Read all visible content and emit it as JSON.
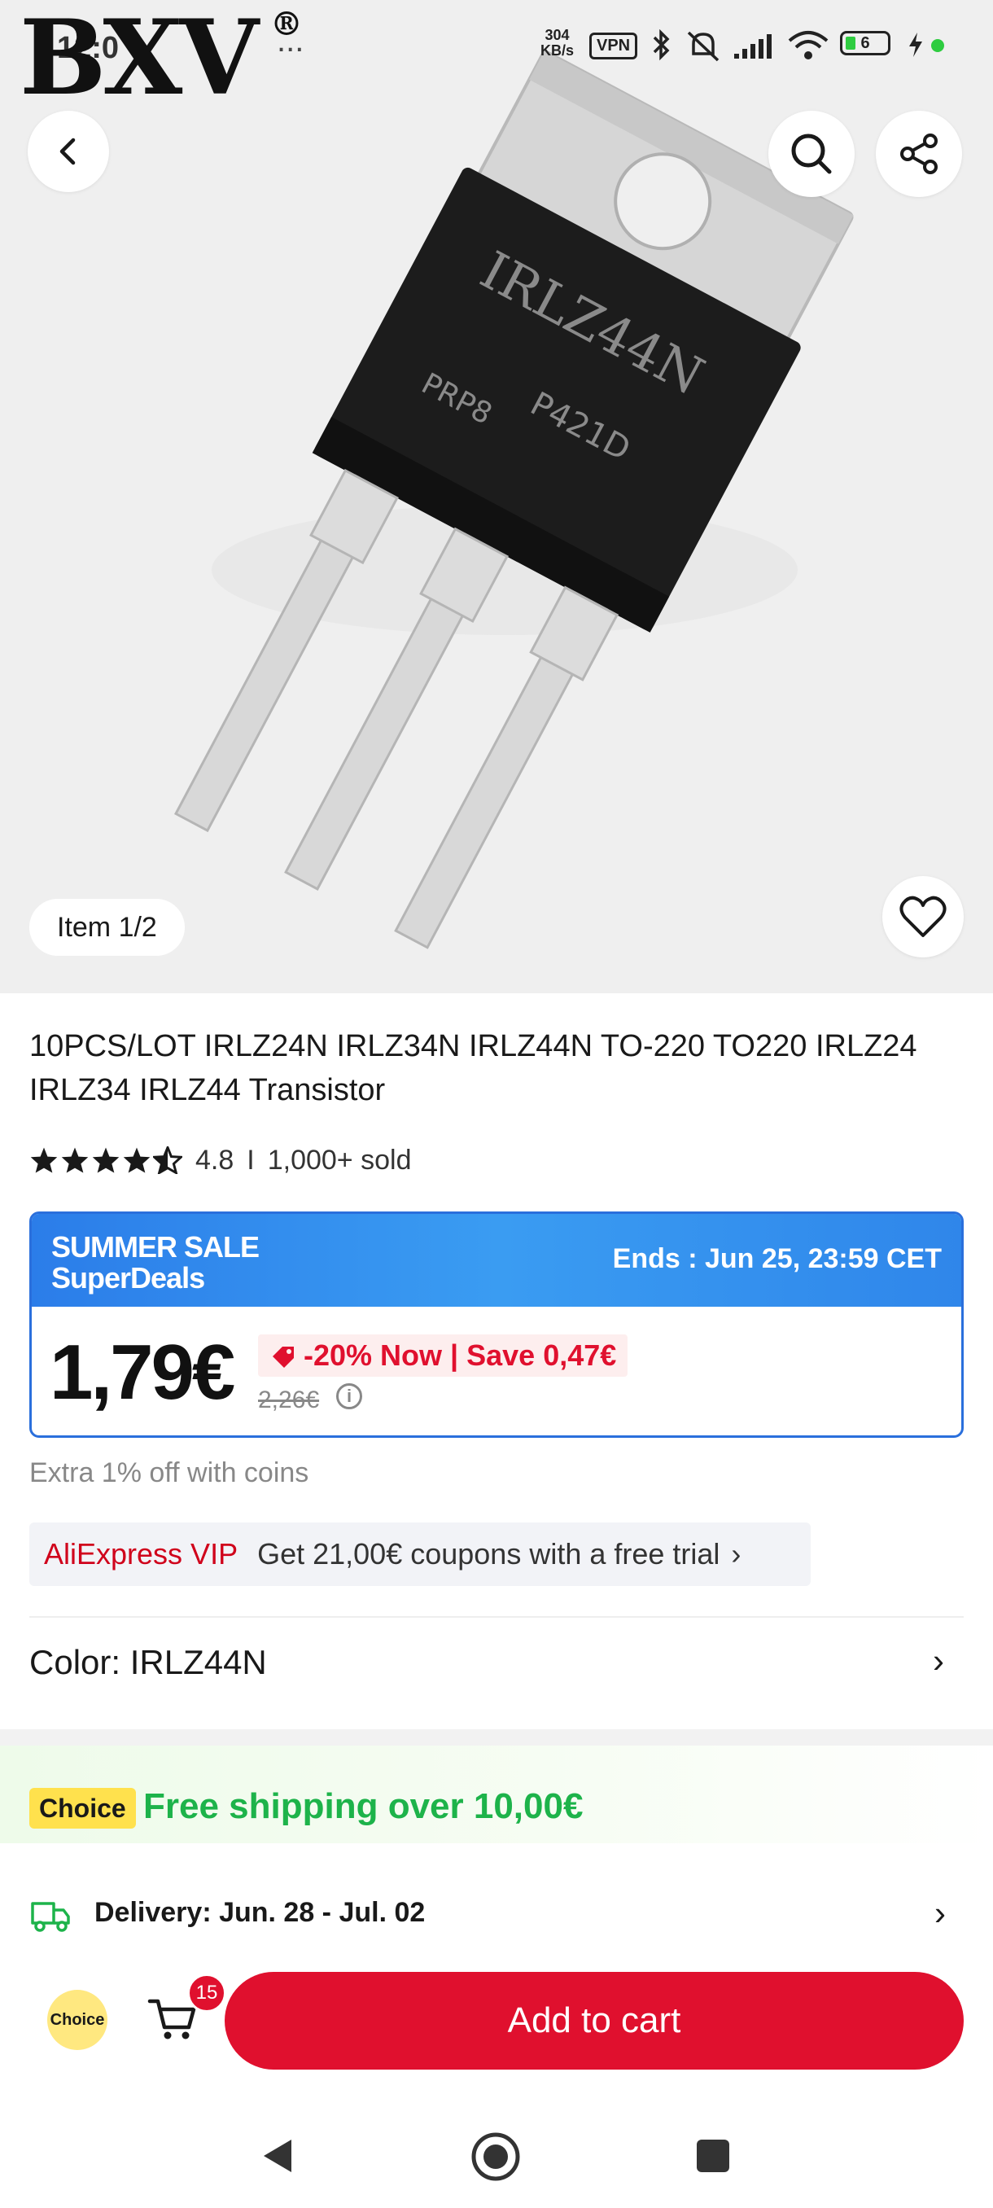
{
  "status_bar": {
    "time": "12:0",
    "speed_value": "304",
    "speed_unit": "KB/s",
    "vpn": "VPN",
    "battery": "6",
    "more_dots": "..."
  },
  "watermark": {
    "logo": "BXV",
    "registered": "®"
  },
  "gallery": {
    "item_counter": "Item 1/2",
    "chip_text": "IRLZ44N",
    "chip_code1": "P421D",
    "chip_code2": "PRP8"
  },
  "product": {
    "title": "10PCS/LOT IRLZ24N IRLZ34N IRLZ44N TO-220 TO220 IRLZ24 IRLZ34 IRLZ44 Transistor",
    "rating": "4.8",
    "sold": "1,000+ sold",
    "rating_separator": "I"
  },
  "sale": {
    "line1": "SUMMER SALE",
    "line2": "SuperDeals",
    "ends": "Ends :  Jun 25, 23:59 CET",
    "price": "1,79€",
    "discount": "-20% Now | Save 0,47€",
    "old_price": "2,26€",
    "info_symbol": "i"
  },
  "coins_text": "Extra 1% off with coins",
  "vip": {
    "brand": "AliExpress VIP",
    "text": "Get 21,00€ coupons with a free trial",
    "chevron": "›"
  },
  "color_option": {
    "label": "Color: IRLZ44N",
    "chevron": "›"
  },
  "shipping": {
    "tag": "Choice",
    "free_text": "Free shipping over 10,00€",
    "delivery": "Delivery: Jun. 28 - Jul. 02",
    "chevron": "›"
  },
  "bottom_bar": {
    "choice_label": "Choice",
    "cart_count": "15",
    "add_to_cart": "Add to cart"
  },
  "colors": {
    "accent_red": "#e0102e",
    "sale_blue": "#2b7de9",
    "choice_yellow": "#ffe14d",
    "shipping_green": "#1db34a"
  },
  "icons": [
    "back-arrow-icon",
    "search-icon",
    "share-icon",
    "heart-icon",
    "star-icon",
    "truck-icon",
    "cart-icon",
    "nav-back-icon",
    "nav-home-icon",
    "nav-recent-icon"
  ]
}
